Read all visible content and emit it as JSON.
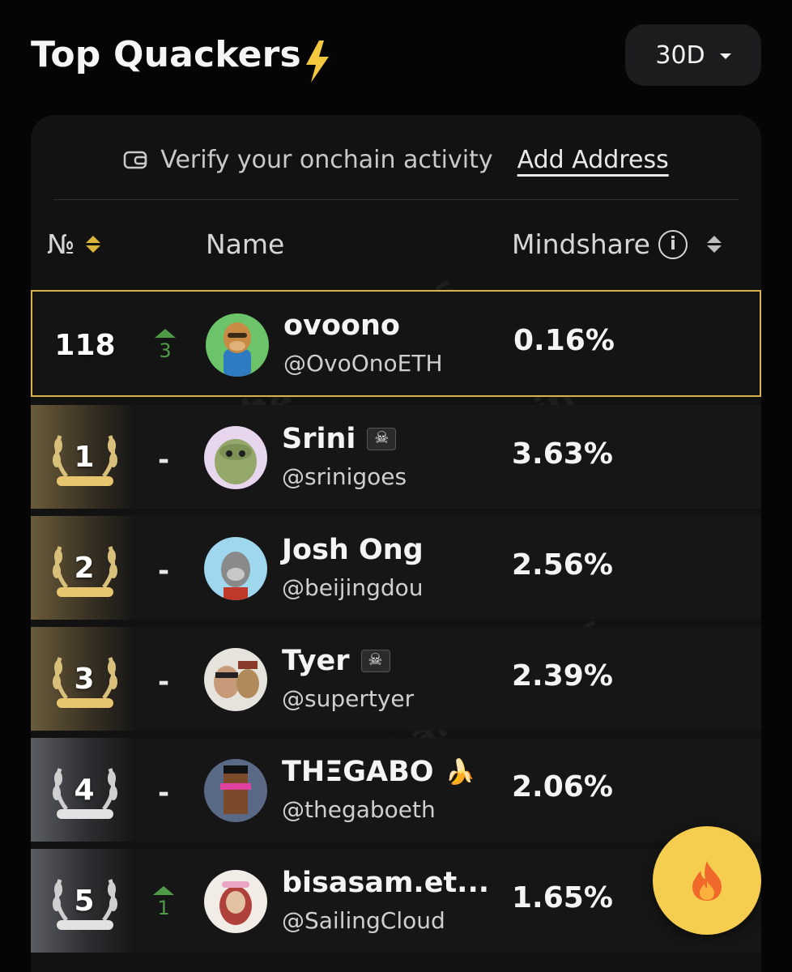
{
  "header": {
    "title": "Top Quackers",
    "period": "30D"
  },
  "verify": {
    "text": "Verify your onchain activity",
    "link": "Add Address"
  },
  "columns": {
    "rank": "№",
    "name": "Name",
    "mindshare": "Mindshare"
  },
  "current_user": {
    "rank": "118",
    "change": "3",
    "change_dir": "up",
    "name": "ovoono",
    "handle": "@OvoOnoETH",
    "mindshare": "0.16%"
  },
  "rows": [
    {
      "rank": "1",
      "change": "-",
      "name": "Srini",
      "flag": "pirate-flag",
      "handle": "@srinigoes",
      "mindshare": "3.63%",
      "tier": "gold"
    },
    {
      "rank": "2",
      "change": "-",
      "name": "Josh Ong",
      "handle": "@beijingdou",
      "mindshare": "2.56%",
      "tier": "gold"
    },
    {
      "rank": "3",
      "change": "-",
      "name": "Tyer",
      "flag": "pirate-flag",
      "handle": "@supertyer",
      "mindshare": "2.39%",
      "tier": "gold"
    },
    {
      "rank": "4",
      "change": "-",
      "name": "THΞGABO",
      "emoji": "🍌",
      "handle": "@thegaboeth",
      "mindshare": "2.06%",
      "tier": "silver"
    },
    {
      "rank": "5",
      "change": "1",
      "change_dir": "up",
      "name": "bisasam.et...",
      "handle": "@SailingCloud",
      "mindshare": "1.65%",
      "tier": "silver"
    }
  ],
  "watermark": "Wallchain Quacks",
  "colors": {
    "highlight_border": "#d8b44c",
    "up": "#4f9a47",
    "fab": "#f5cd4f",
    "gold_sort": "#d9b43a"
  },
  "icons": {
    "title": "lightning-bolt-icon",
    "fab": "fire-icon",
    "verify": "wallet-icon",
    "info": "info-icon"
  }
}
